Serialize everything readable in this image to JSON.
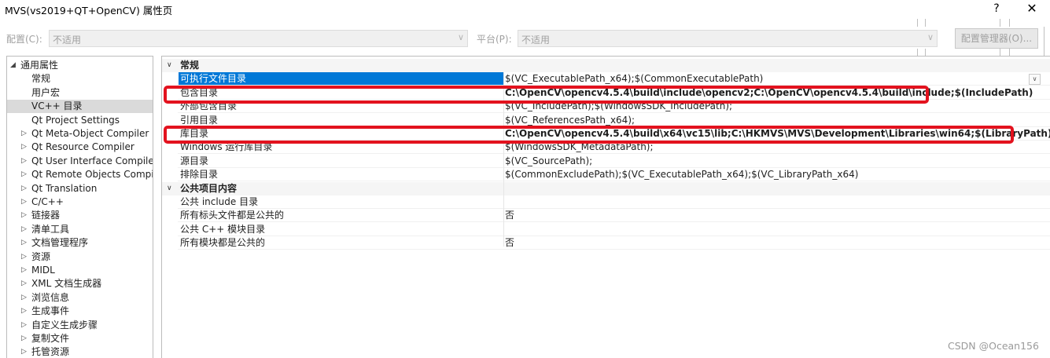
{
  "window": {
    "title": "MVS(vs2019+QT+OpenCV) 属性页",
    "help_label": "?",
    "close_label": "✕"
  },
  "config_bar": {
    "config_label": "配置(C):",
    "config_value": "不适用",
    "platform_label": "平台(P):",
    "platform_value": "不适用",
    "manager_button": "配置管理器(O)..."
  },
  "tree": {
    "root": "通用属性",
    "items": [
      {
        "label": "常规",
        "expandable": false,
        "selected": false
      },
      {
        "label": "用户宏",
        "expandable": false,
        "selected": false
      },
      {
        "label": "VC++ 目录",
        "expandable": false,
        "selected": true
      },
      {
        "label": "Qt Project Settings",
        "expandable": false,
        "selected": false
      },
      {
        "label": "Qt Meta-Object Compiler",
        "expandable": true,
        "selected": false
      },
      {
        "label": "Qt Resource Compiler",
        "expandable": true,
        "selected": false
      },
      {
        "label": "Qt User Interface Compiler",
        "expandable": true,
        "selected": false
      },
      {
        "label": "Qt Remote Objects Compil",
        "expandable": true,
        "selected": false
      },
      {
        "label": "Qt Translation",
        "expandable": true,
        "selected": false
      },
      {
        "label": "C/C++",
        "expandable": true,
        "selected": false
      },
      {
        "label": "链接器",
        "expandable": true,
        "selected": false
      },
      {
        "label": "清单工具",
        "expandable": true,
        "selected": false
      },
      {
        "label": "文档管理程序",
        "expandable": true,
        "selected": false
      },
      {
        "label": "资源",
        "expandable": true,
        "selected": false
      },
      {
        "label": "MIDL",
        "expandable": true,
        "selected": false
      },
      {
        "label": "XML 文档生成器",
        "expandable": true,
        "selected": false
      },
      {
        "label": "浏览信息",
        "expandable": true,
        "selected": false
      },
      {
        "label": "生成事件",
        "expandable": true,
        "selected": false
      },
      {
        "label": "自定义生成步骤",
        "expandable": true,
        "selected": false
      },
      {
        "label": "复制文件",
        "expandable": true,
        "selected": false
      },
      {
        "label": "托管资源",
        "expandable": true,
        "selected": false
      }
    ]
  },
  "grid": {
    "categories": [
      {
        "title": "常规",
        "rows": [
          {
            "name": "可执行文件目录",
            "value": "$(VC_ExecutablePath_x64);$(CommonExecutablePath)",
            "bold": false,
            "selected": true
          },
          {
            "name": "包含目录",
            "value": "C:\\OpenCV\\opencv4.5.4\\build\\include\\opencv2;C:\\OpenCV\\opencv4.5.4\\build\\include;$(IncludePath)",
            "bold": true,
            "selected": false
          },
          {
            "name": "外部包含目录",
            "value": "$(VC_IncludePath);$(WindowsSDK_IncludePath);",
            "bold": false,
            "selected": false
          },
          {
            "name": "引用目录",
            "value": "$(VC_ReferencesPath_x64);",
            "bold": false,
            "selected": false
          },
          {
            "name": "库目录",
            "value": "C:\\OpenCV\\opencv4.5.4\\build\\x64\\vc15\\lib;C:\\HKMVS\\MVS\\Development\\Libraries\\win64;$(LibraryPath)",
            "bold": true,
            "selected": false
          },
          {
            "name": "Windows 运行库目录",
            "value": "$(WindowsSDK_MetadataPath);",
            "bold": false,
            "selected": false
          },
          {
            "name": "源目录",
            "value": "$(VC_SourcePath);",
            "bold": false,
            "selected": false
          },
          {
            "name": "排除目录",
            "value": "$(CommonExcludePath);$(VC_ExecutablePath_x64);$(VC_LibraryPath_x64)",
            "bold": false,
            "selected": false
          }
        ]
      },
      {
        "title": "公共项目内容",
        "rows": [
          {
            "name": "公共 include 目录",
            "value": "",
            "bold": false,
            "selected": false
          },
          {
            "name": "所有标头文件都是公共的",
            "value": "否",
            "bold": false,
            "selected": false
          },
          {
            "name": "公共 C++ 模块目录",
            "value": "",
            "bold": false,
            "selected": false
          },
          {
            "name": "所有模块都是公共的",
            "value": "否",
            "bold": false,
            "selected": false
          }
        ]
      }
    ]
  },
  "highlight_color": "#e3121e",
  "selection_color": "#0078d7",
  "watermark": "CSDN @Ocean156"
}
